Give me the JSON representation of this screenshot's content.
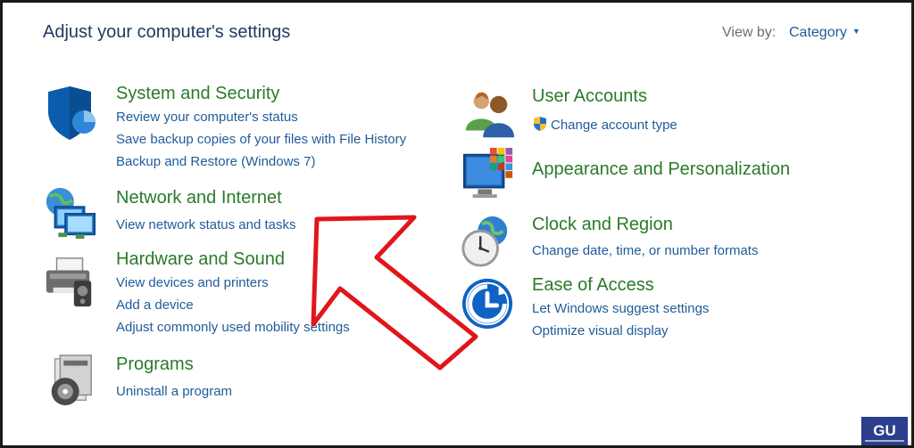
{
  "header": {
    "title": "Adjust your computer's settings",
    "view_by_label": "View by:",
    "view_by_value": "Category"
  },
  "categories": {
    "system": {
      "title": "System and Security",
      "links": [
        "Review your computer's status",
        "Save backup copies of your files with File History",
        "Backup and Restore (Windows 7)"
      ]
    },
    "network": {
      "title": "Network and Internet",
      "links": [
        "View network status and tasks"
      ]
    },
    "hardware": {
      "title": "Hardware and Sound",
      "links": [
        "View devices and printers",
        "Add a device",
        "Adjust commonly used mobility settings"
      ]
    },
    "programs": {
      "title": "Programs",
      "links": [
        "Uninstall a program"
      ]
    },
    "users": {
      "title": "User Accounts",
      "links": [
        "Change account type"
      ]
    },
    "appearance": {
      "title": "Appearance and Personalization",
      "links": []
    },
    "clock": {
      "title": "Clock and Region",
      "links": [
        "Change date, time, or number formats"
      ]
    },
    "access": {
      "title": "Ease of Access",
      "links": [
        "Let Windows suggest settings",
        "Optimize visual display"
      ]
    }
  },
  "colors": {
    "title_green": "#2a7a2a",
    "link_blue": "#1f5c99",
    "arrow_red": "#e0161b",
    "heading": "#1e3a5f"
  },
  "icons": [
    "shield-icon",
    "network-icon",
    "printer-icon",
    "programs-icon",
    "users-icon",
    "appearance-icon",
    "clock-icon",
    "ease-of-access-icon"
  ],
  "watermark": "GU"
}
